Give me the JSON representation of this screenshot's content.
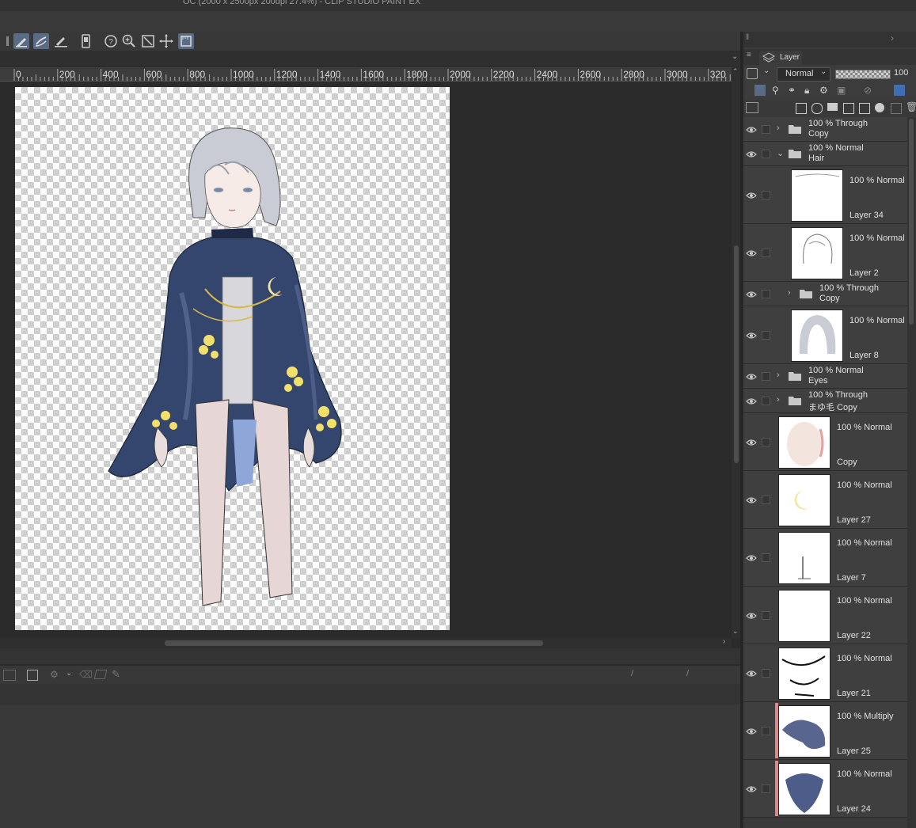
{
  "window": {
    "title": "OC (2000 x 2500px 200dpi 27.4%)  - CLIP STUDIO PAINT EX"
  },
  "ruler": {
    "ticks": [
      "0",
      "200",
      "400",
      "600",
      "800",
      "1000",
      "1200",
      "1400",
      "1600",
      "1800",
      "2000",
      "2200",
      "2400",
      "2600",
      "2800",
      "3000",
      "320"
    ]
  },
  "toolbar": {
    "icons": [
      "pen-icon",
      "brush-icon",
      "ruler-pen-icon",
      "device-icon",
      "help-icon",
      "zoom-in-icon",
      "fit-icon",
      "move-icon",
      "ruler-icon"
    ]
  },
  "layer_panel": {
    "tab_label": "Layer",
    "blend_mode": "Normal",
    "opacity": "100",
    "layers": [
      {
        "opacity_mode": "100 % Through",
        "name": "Copy",
        "type": "folder",
        "indent": 0,
        "expanded": false
      },
      {
        "opacity_mode": "100 % Normal",
        "name": "Hair",
        "type": "folder",
        "indent": 0,
        "expanded": true
      },
      {
        "opacity_mode": "100 % Normal",
        "name": "Layer 34",
        "type": "raster",
        "indent": 1
      },
      {
        "opacity_mode": "100 % Normal",
        "name": "Layer 2",
        "type": "raster",
        "indent": 1
      },
      {
        "opacity_mode": "100 % Through",
        "name": "Copy",
        "type": "folder",
        "indent": 1,
        "expanded": false
      },
      {
        "opacity_mode": "100 % Normal",
        "name": "Layer 8",
        "type": "raster",
        "indent": 1
      },
      {
        "opacity_mode": "100 % Normal",
        "name": "Eyes",
        "type": "folder",
        "indent": 0,
        "expanded": false
      },
      {
        "opacity_mode": "100 % Through",
        "name": "まゆ毛 Copy",
        "type": "folder",
        "indent": 0,
        "expanded": false
      },
      {
        "opacity_mode": "100 % Normal",
        "name": "Copy",
        "type": "raster",
        "indent": 0
      },
      {
        "opacity_mode": "100 % Normal",
        "name": "Layer 27",
        "type": "raster",
        "indent": 0
      },
      {
        "opacity_mode": "100 % Normal",
        "name": "Layer 7",
        "type": "raster",
        "indent": 0
      },
      {
        "opacity_mode": "100 % Normal",
        "name": "Layer 22",
        "type": "raster",
        "indent": 0
      },
      {
        "opacity_mode": "100 % Normal",
        "name": "Layer 21",
        "type": "raster",
        "indent": 0
      },
      {
        "opacity_mode": "100 % Multiply",
        "name": "Layer 25",
        "type": "raster",
        "indent": 0,
        "clipped": true
      },
      {
        "opacity_mode": "100 % Normal",
        "name": "Layer 24",
        "type": "raster",
        "indent": 0,
        "clipped": true
      }
    ]
  },
  "status": {
    "slash_1": "/",
    "slash_2": "/"
  }
}
